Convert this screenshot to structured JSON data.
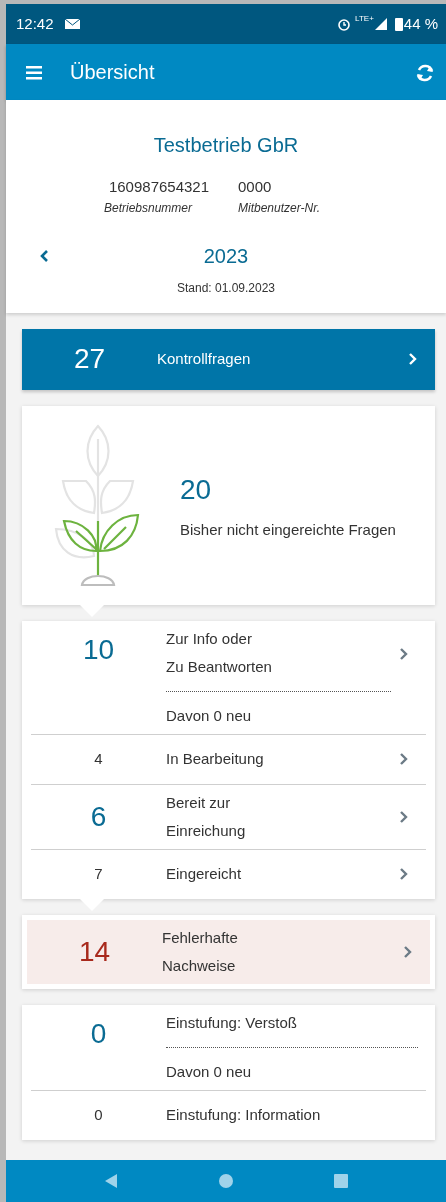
{
  "status_bar": {
    "time": "12:42",
    "network": "LTE+",
    "battery": "44 %"
  },
  "app_bar": {
    "title": "Übersicht"
  },
  "company": {
    "name": "Testbetrieb GbR",
    "fields": [
      {
        "value": "160987654321",
        "label": "Betriebsnummer"
      },
      {
        "value": "0000",
        "label": "Mitbenutzer-Nr."
      }
    ]
  },
  "year": {
    "value": "2023",
    "stand": "Stand: 01.09.2023"
  },
  "summary": {
    "count": "27",
    "label": "Kontrollfragen"
  },
  "pending": {
    "count": "20",
    "label": "Bisher nicht eingereichte Fragen"
  },
  "groups": [
    {
      "kind": "plain",
      "pointer": true,
      "rows": [
        {
          "count": "10",
          "kind": "primary",
          "lines": [
            "Zur Info oder",
            "Zu Beantworten"
          ],
          "note": "Davon 0 neu",
          "chevron": true
        },
        {
          "count": "4",
          "kind": "secondary",
          "lines": [
            "In Bearbeitung"
          ],
          "chevron": true
        },
        {
          "count": "6",
          "kind": "primary",
          "lines": [
            "Bereit zur",
            "Einreichung"
          ],
          "chevron": true
        },
        {
          "count": "7",
          "kind": "secondary",
          "lines": [
            "Eingereicht"
          ],
          "chevron": true
        }
      ]
    },
    {
      "kind": "error",
      "pointer": false,
      "rows": [
        {
          "count": "14",
          "kind": "error",
          "lines": [
            "Fehlerhafte",
            "Nachweise"
          ],
          "chevron": true
        }
      ]
    },
    {
      "kind": "plain",
      "pointer": false,
      "rows": [
        {
          "count": "0",
          "kind": "primary",
          "lines": [
            "Einstufung: Verstoß"
          ],
          "note": "Davon 0 neu",
          "chevron": false
        },
        {
          "count": "0",
          "kind": "secondary",
          "lines": [
            "Einstufung: Information"
          ],
          "chevron": false
        }
      ]
    }
  ]
}
